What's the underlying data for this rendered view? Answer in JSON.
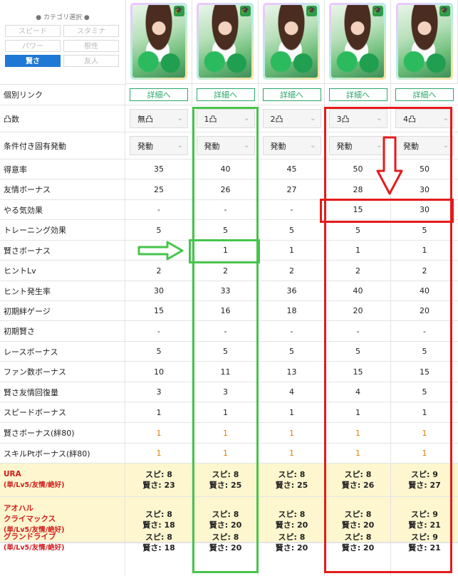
{
  "category": {
    "title": "● カテゴリ選択 ●",
    "buttons": [
      {
        "label": "スピード",
        "active": false
      },
      {
        "label": "スタミナ",
        "active": false
      },
      {
        "label": "パワー",
        "active": false
      },
      {
        "label": "根性",
        "active": false
      },
      {
        "label": "賢さ",
        "active": true
      },
      {
        "label": "友人",
        "active": false
      }
    ]
  },
  "columns": [
    "無凸",
    "1凸",
    "2凸",
    "3凸",
    "4凸"
  ],
  "detail_label": "詳細へ",
  "activation_label": "発動",
  "rows": {
    "link": "個別リンク",
    "breakthrough": "凸数",
    "unique": "条件付き固有発動"
  },
  "stats": [
    {
      "label": "得意率",
      "values": [
        "35",
        "40",
        "45",
        "50",
        "50"
      ]
    },
    {
      "label": "友情ボーナス",
      "values": [
        "25",
        "26",
        "27",
        "28",
        "30"
      ]
    },
    {
      "label": "やる気効果",
      "values": [
        "-",
        "-",
        "-",
        "15",
        "30"
      ]
    },
    {
      "label": "トレーニング効果",
      "values": [
        "5",
        "5",
        "5",
        "5",
        "5"
      ]
    },
    {
      "label": "賢さボーナス",
      "values": [
        "1",
        "1",
        "1",
        "1",
        "1"
      ]
    },
    {
      "label": "ヒントLv",
      "values": [
        "2",
        "2",
        "2",
        "2",
        "2"
      ]
    },
    {
      "label": "ヒント発生率",
      "values": [
        "30",
        "33",
        "36",
        "40",
        "40"
      ]
    },
    {
      "label": "初期絆ゲージ",
      "values": [
        "15",
        "16",
        "18",
        "20",
        "20"
      ]
    },
    {
      "label": "初期賢さ",
      "values": [
        "-",
        "-",
        "-",
        "-",
        "-"
      ]
    },
    {
      "label": "レースボーナス",
      "values": [
        "5",
        "5",
        "5",
        "5",
        "5"
      ]
    },
    {
      "label": "ファン数ボーナス",
      "values": [
        "10",
        "11",
        "13",
        "15",
        "15"
      ]
    },
    {
      "label": "賢さ友情回復量",
      "values": [
        "3",
        "3",
        "4",
        "4",
        "5"
      ]
    },
    {
      "label": "スピードボーナス",
      "values": [
        "1",
        "1",
        "1",
        "1",
        "1"
      ]
    },
    {
      "label": "賢さボーナス(絆80)",
      "values": [
        "1",
        "1",
        "1",
        "1",
        "1"
      ]
    },
    {
      "label": "スキルPtボーナス(絆80)",
      "values": [
        "1",
        "1",
        "1",
        "1",
        "1"
      ]
    }
  ],
  "scenarios": [
    {
      "label": "URA",
      "sub": "(単/Lv5/友情/絶好)",
      "speed": [
        "スピ: 8",
        "スピ: 8",
        "スピ: 8",
        "スピ: 8",
        "スピ: 9"
      ],
      "wis": [
        "賢さ: 23",
        "賢さ: 25",
        "賢さ: 25",
        "賢さ: 26",
        "賢さ: 27"
      ]
    },
    {
      "label": "アオハル",
      "label2": "クライマックス",
      "sub": "(単/Lv5/友情/絶好)",
      "speed": [
        "スピ: 8",
        "スピ: 8",
        "スピ: 8",
        "スピ: 8",
        "スピ: 9"
      ],
      "wis": [
        "賢さ: 18",
        "賢さ: 20",
        "賢さ: 20",
        "賢さ: 20",
        "賢さ: 21"
      ]
    },
    {
      "label": "グランドライブ",
      "sub": "(単/Lv5/友情/絶好)",
      "speed": [
        "スピ: 8",
        "スピ: 8",
        "スピ: 8",
        "スピ: 8",
        "スピ: 9"
      ],
      "wis": [
        "賢さ: 18",
        "賢さ: 20",
        "賢さ: 20",
        "賢さ: 20",
        "賢さ: 21"
      ]
    }
  ],
  "colors": {
    "active": "#1e78d4",
    "link": "#2aa86a",
    "green_highlight": "#47c44b",
    "red_highlight": "#e41b1b",
    "orange_value": "#e07b00",
    "scenario_label": "#d21c1c",
    "scenario_bg": "#fdf6cf"
  }
}
